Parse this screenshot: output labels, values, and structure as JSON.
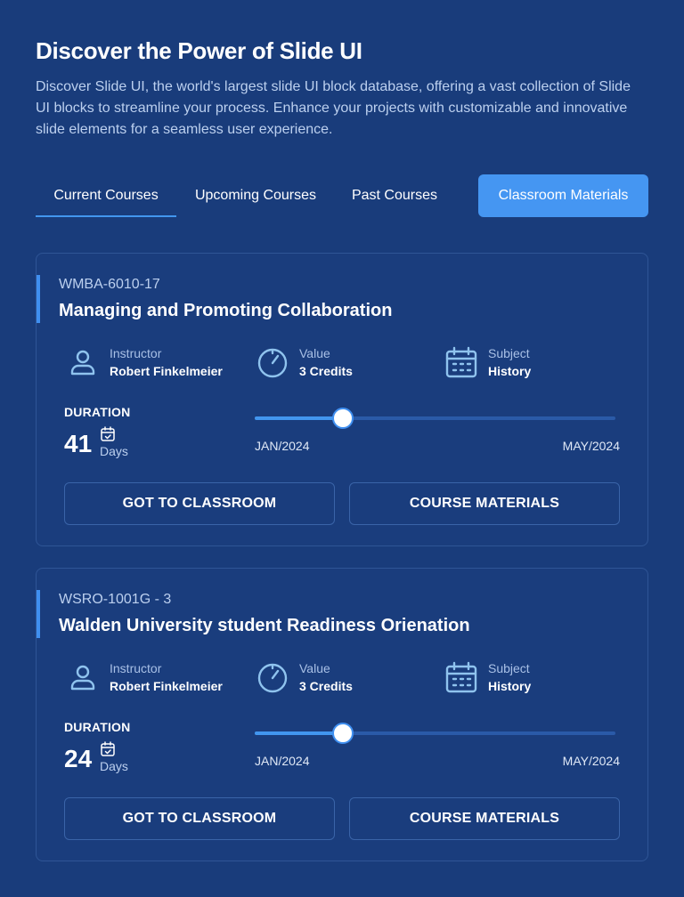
{
  "header": {
    "title": "Discover the Power of Slide UI",
    "description": "Discover Slide UI, the world's largest slide UI block database, offering a vast collection of Slide UI blocks to streamline your process. Enhance your projects with customizable and innovative slide elements for a seamless user experience."
  },
  "tabs": [
    {
      "label": "Current Courses",
      "active": true
    },
    {
      "label": "Upcoming Courses",
      "active": false
    },
    {
      "label": "Past Courses",
      "active": false
    },
    {
      "label": "Classroom Materials",
      "active": false
    }
  ],
  "courses": [
    {
      "code": "WMBA-6010-17",
      "title": "Managing and Promoting Collaboration",
      "instructor_label": "Instructor",
      "instructor": "Robert Finkelmeier",
      "value_label": "Value",
      "value": "3 Credits",
      "subject_label": "Subject",
      "subject": "History",
      "duration_label": "DURATION",
      "duration_value": "41",
      "duration_unit": "Days",
      "progress_percent": 24.5,
      "range_start": "JAN/2024",
      "range_end": "MAY/2024",
      "primary_button": "GOT TO CLASSROOM",
      "secondary_button": "COURSE MATERIALS"
    },
    {
      "code": "WSRO-1001G - 3",
      "title": "Walden University student Readiness Orienation",
      "instructor_label": "Instructor",
      "instructor": "Robert Finkelmeier",
      "value_label": "Value",
      "value": "3 Credits",
      "subject_label": "Subject",
      "subject": "History",
      "duration_label": "DURATION",
      "duration_value": "24",
      "duration_unit": "Days",
      "progress_percent": 24.5,
      "range_start": "JAN/2024",
      "range_end": "MAY/2024",
      "primary_button": "GOT TO CLASSROOM",
      "secondary_button": "COURSE MATERIALS"
    }
  ],
  "icons": {
    "instructor": "user-icon",
    "value": "gauge-icon",
    "subject": "calendar-icon",
    "duration": "calendar-check-icon"
  },
  "colors": {
    "background": "#193c7b",
    "accent": "#4296ef",
    "button_active": "#4596f2",
    "card_border": "#2f5596",
    "icon": "#8fc3ee"
  }
}
